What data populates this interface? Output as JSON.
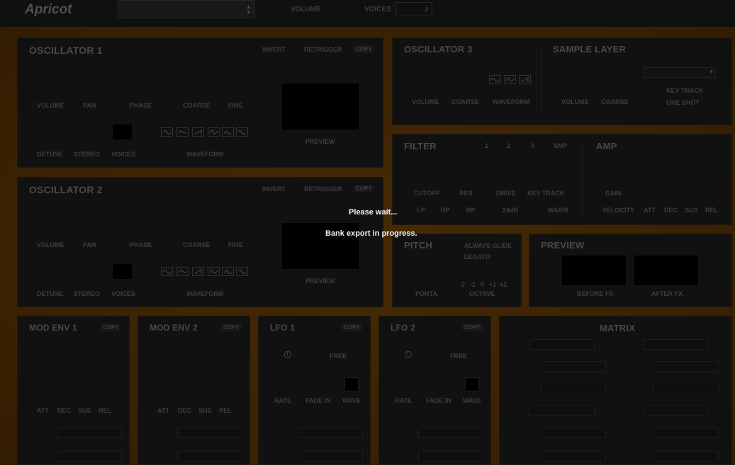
{
  "header": {
    "logo": "Apricot",
    "volume_label": "VOLUME",
    "voices_label": "VOICES",
    "voices_icon": "music-note-icon"
  },
  "osc1": {
    "title": "OSCILLATOR 1",
    "invert": "INVERT",
    "retrigger": "RETRIGGER",
    "copy": "COPY",
    "volume": "VOLUME",
    "pan": "PAN",
    "phase": "PHASE",
    "coarse": "COARSE",
    "fine": "FINE",
    "detune": "DETUNE",
    "stereo": "STEREO",
    "voices": "VOICES",
    "waveform": "WAVEFORM",
    "preview": "PREVIEW"
  },
  "osc2": {
    "title": "OSCILLATOR 2",
    "invert": "INVERT",
    "retrigger": "RETRIGGER",
    "copy": "COPY",
    "volume": "VOLUME",
    "pan": "PAN",
    "phase": "PHASE",
    "coarse": "COARSE",
    "fine": "FINE",
    "detune": "DETUNE",
    "stereo": "STEREO",
    "voices": "VOICES",
    "waveform": "WAVEFORM",
    "preview": "PREVIEW"
  },
  "osc3": {
    "title": "OSCILLATOR 3",
    "volume": "VOLUME",
    "coarse": "COARSE",
    "waveform": "WAVEFORM"
  },
  "sample": {
    "title": "SAMPLE LAYER",
    "volume": "VOLUME",
    "coarse": "COARSE",
    "key_track": "KEY TRACK",
    "one_shot": "ONE SHOT"
  },
  "filter": {
    "title": "FILTER",
    "src1": "1",
    "src2": "2",
    "src3": "3",
    "srcs": "SMP",
    "cutoff": "CUTOFF",
    "res": "RES",
    "drive": "DRIVE",
    "key_track": "KEY TRACK",
    "lp": "LP",
    "hp": "HP",
    "bp": "BP",
    "db": "24dB",
    "warm": "WARM"
  },
  "amp": {
    "title": "AMP",
    "gain": "GAIN",
    "velocity": "VELOCITY",
    "att": "ATT",
    "dec": "DEC",
    "sus": "SUS",
    "rel": "REL"
  },
  "pitch": {
    "title": "PITCH",
    "always_glide": "ALWAYS GLIDE",
    "legato": "LEGATO",
    "oct_m2": "-2",
    "oct_m1": "-1",
    "oct_0": "0",
    "oct_p1": "+1",
    "oct_p2": "+2",
    "porta": "PORTA",
    "octave": "OCTAVE"
  },
  "preview": {
    "title": "PREVIEW",
    "before_fx": "BEFORE FX",
    "after_fx": "AFTER FX"
  },
  "modenv1": {
    "title": "MOD ENV 1",
    "copy": "COPY",
    "att": "ATT",
    "dec": "DEC",
    "sus": "SUS",
    "rel": "REL"
  },
  "modenv2": {
    "title": "MOD ENV 2",
    "copy": "COPY",
    "att": "ATT",
    "dec": "DEC",
    "sus": "SUS",
    "rel": "REL"
  },
  "lfo1": {
    "title": "LFO 1",
    "copy": "COPY",
    "free": "FREE",
    "rate": "RATE",
    "fade_in": "FADE IN",
    "wave": "WAVE"
  },
  "lfo2": {
    "title": "LFO 2",
    "copy": "COPY",
    "free": "FREE",
    "rate": "RATE",
    "fade_in": "FADE IN",
    "wave": "WAVE"
  },
  "matrix": {
    "title": "MATRIX"
  },
  "overlay": {
    "line1": "Please wait...",
    "line2": "Bank export in progress."
  }
}
